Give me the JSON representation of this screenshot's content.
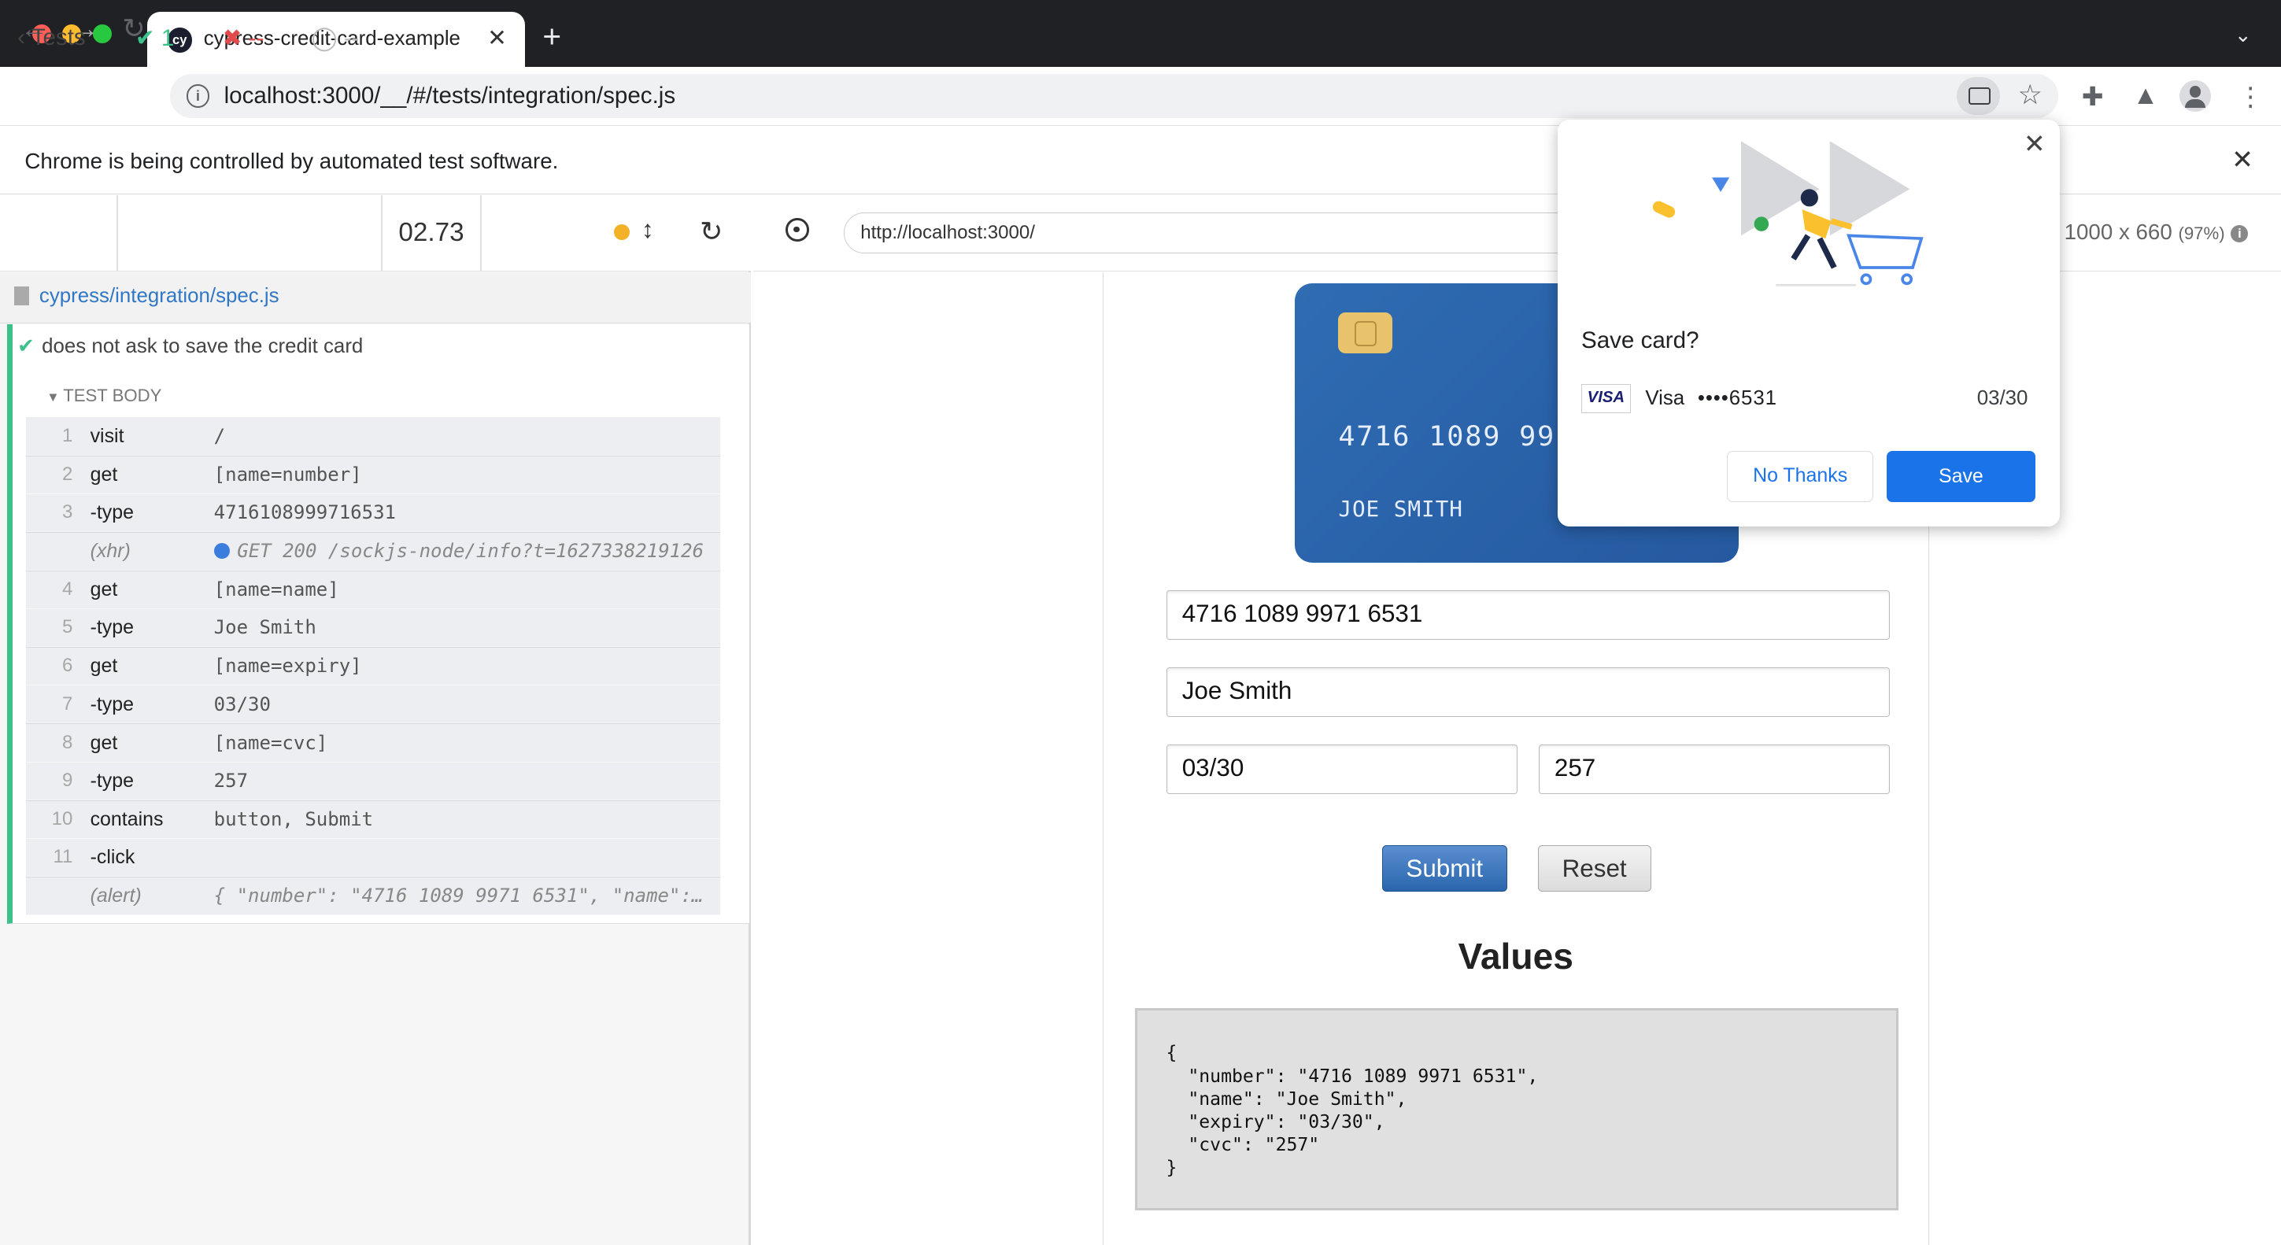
{
  "browser": {
    "tab_title": "cypress-credit-card-example",
    "tab_logo": "cy",
    "address": "localhost:3000/__/#/tests/integration/spec.js",
    "infobar_message": "Chrome is being controlled by automated test software."
  },
  "reporter": {
    "tests_label": "Tests",
    "passed": "1",
    "failed": "--",
    "pending": "--",
    "duration": "02.73",
    "spec_path": "cypress/integration/spec.js",
    "test_title": "does not ask to save the credit card",
    "section_label": "TEST BODY",
    "commands": [
      {
        "num": "1",
        "name": "visit",
        "arg": "/"
      },
      {
        "num": "2",
        "name": "get",
        "arg": "[name=number]"
      },
      {
        "num": "3",
        "name": "-type",
        "arg": "4716108999716531"
      },
      {
        "num": "",
        "name": "(xhr)",
        "arg": "GET 200 /sockjs-node/info?t=1627338219126"
      },
      {
        "num": "4",
        "name": "get",
        "arg": "[name=name]"
      },
      {
        "num": "5",
        "name": "-type",
        "arg": "Joe Smith"
      },
      {
        "num": "6",
        "name": "get",
        "arg": "[name=expiry]"
      },
      {
        "num": "7",
        "name": "-type",
        "arg": "03/30"
      },
      {
        "num": "8",
        "name": "get",
        "arg": "[name=cvc]"
      },
      {
        "num": "9",
        "name": "-type",
        "arg": "257"
      },
      {
        "num": "10",
        "name": "contains",
        "arg": "button, Submit"
      },
      {
        "num": "11",
        "name": "-click",
        "arg": ""
      },
      {
        "num": "",
        "name": "(alert)",
        "arg": "{ \"number\": \"4716 1089 9971 6531\", \"name\":…"
      }
    ]
  },
  "aut": {
    "url": "http://localhost:3000/",
    "viewport": "1000 x 660",
    "scale": "(97%)",
    "card_number_display": "4716 1089 99",
    "card_holder": "JOE SMITH",
    "number_value": "4716 1089 9971 6531",
    "name_value": "Joe Smith",
    "expiry_value": "03/30",
    "cvc_value": "257",
    "submit_label": "Submit",
    "reset_label": "Reset",
    "values_title": "Values",
    "values_json": "{\n  \"number\": \"4716 1089 9971 6531\",\n  \"name\": \"Joe Smith\",\n  \"expiry\": \"03/30\",\n  \"cvc\": \"257\"\n}"
  },
  "popup": {
    "title": "Save card?",
    "brand": "VISA",
    "card_name": "Visa",
    "card_masked": "••••6531",
    "expiry": "03/30",
    "no_thanks": "No Thanks",
    "save": "Save"
  },
  "colors": {
    "pass": "#3cc18b",
    "fail": "#e24b4b",
    "link": "#3077c6",
    "chrome_blue": "#1a73e8"
  }
}
